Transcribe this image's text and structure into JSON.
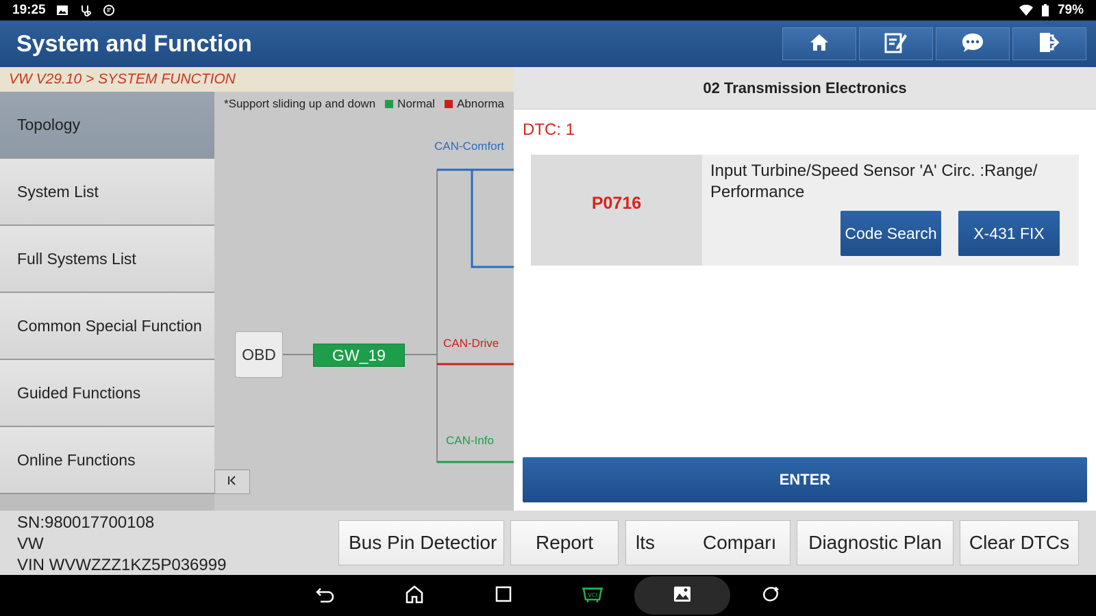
{
  "status_bar": {
    "time": "19:25",
    "battery": "79%"
  },
  "header": {
    "title": "System and Function"
  },
  "breadcrumb": "VW V29.10 > SYSTEM FUNCTION",
  "menu": [
    {
      "label": "Topology",
      "active": true
    },
    {
      "label": "System List"
    },
    {
      "label": "Full Systems List"
    },
    {
      "label": "Common Special Function"
    },
    {
      "label": "Guided Functions"
    },
    {
      "label": "Online Functions"
    }
  ],
  "topology": {
    "legend_note": "*Support sliding up and down",
    "legend_normal": "Normal",
    "legend_abnormal": "Abnorma",
    "bus_comfort": "CAN-Comfort",
    "bus_drive": "CAN-Drive",
    "bus_info": "CAN-Info",
    "obd": "OBD",
    "gateway": "GW_19",
    "colors": {
      "normal": "#1e9d4a",
      "abnormal": "#c8211c",
      "comfort": "#2a6cc0",
      "drive": "#c8211c",
      "info": "#1e9d4a"
    }
  },
  "panel": {
    "title": "02 Transmission Electronics",
    "dtc_count": "DTC: 1",
    "dtc": {
      "code": "P0716",
      "description": "Input Turbine/Speed Sensor 'A' Circ. :Range/ Performance",
      "code_search": "Code Search",
      "fix": "X-431 FIX"
    },
    "enter": "ENTER"
  },
  "vehicle": {
    "sn": "SN:980017700108",
    "make": "VW",
    "vin": "VIN WVWZZZ1KZ5P036999"
  },
  "bottom_buttons": {
    "bus_pin": "Bus Pin Detectior",
    "report": "Report",
    "results_partial": "lts",
    "compare": "Comparı",
    "diagnostic_plan": "Diagnostic Plan",
    "clear_dtcs": "Clear DTCs"
  },
  "icons": {
    "home": "home-icon",
    "edit": "edit-icon",
    "chat": "chat-icon",
    "exit": "exit-icon"
  }
}
